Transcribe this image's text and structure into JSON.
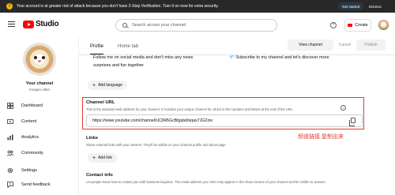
{
  "banner": {
    "icon": "warning-icon",
    "message": "Your account is at greater risk of attack because you don't have 2-Step Verification. Turn it on now for extra security.",
    "get_started": "Get started",
    "dismiss": "Dismiss"
  },
  "header": {
    "logo_text": "Studio",
    "search_placeholder": "Search across your channel",
    "create_label": "Create"
  },
  "sidebar": {
    "channel_title": "Your channel",
    "channel_subtitle": "Imogen Allen",
    "items": [
      {
        "label": "Dashboard",
        "icon": "dashboard-icon"
      },
      {
        "label": "Content",
        "icon": "content-icon"
      },
      {
        "label": "Analytics",
        "icon": "analytics-icon"
      },
      {
        "label": "Community",
        "icon": "community-icon"
      },
      {
        "label": "Settings",
        "icon": "gear-icon"
      },
      {
        "label": "Send feedback",
        "icon": "feedback-icon"
      }
    ]
  },
  "tabs": [
    {
      "label": "Profile",
      "active": true
    },
    {
      "label": "Home tab",
      "active": false
    }
  ],
  "actions": {
    "view_channel": "View channel",
    "cancel": "Cancel",
    "publish": "Publish"
  },
  "description": {
    "line1": "Follow me on social media and don't miss any news",
    "line1b": "Subscribe to my channel and let's discover more",
    "line2": "surprises and fun together"
  },
  "add_language": "Add language",
  "channel_url": {
    "title": "Channel URL",
    "desc": "This is the standard web address for your channel. It includes your unique channel ID, which is the numbers and letters at the end of the URL.",
    "url": "https://www.youtube.com/channel/UC845GcBtgqla9sqas7JG2zw"
  },
  "links": {
    "title": "Links",
    "desc": "Share external links with your viewers. They'll be visible on your channel profile and about page",
    "add": "Add link"
  },
  "contact": {
    "title": "Contact info",
    "desc": "Let people know how to contact you with business inquiries. The email address you enter may appear in the About section of your channel and be visible to viewers."
  },
  "annotation": "频道链接 复制出来",
  "colors": {
    "accent": "#ff0000",
    "highlight": "#e53935"
  }
}
